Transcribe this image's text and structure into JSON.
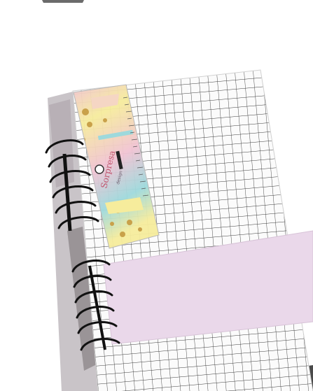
{
  "photo": {
    "subject": "",
    "colors": {
      "background": "#ffffff",
      "paper": "#fbfbfb",
      "grid_line": "#3a3a3a",
      "sticky_note": "#ead8ea",
      "ruler_pink": "#f1c3d3",
      "ruler_yellow": "#f6ec9c",
      "ruler_teal": "#9ed9dc",
      "spiral": "#111111",
      "cover_strip": "#c4bfc3"
    }
  },
  "ruler": {
    "brand_text": "Sorpresa",
    "brand_sub": "design"
  }
}
